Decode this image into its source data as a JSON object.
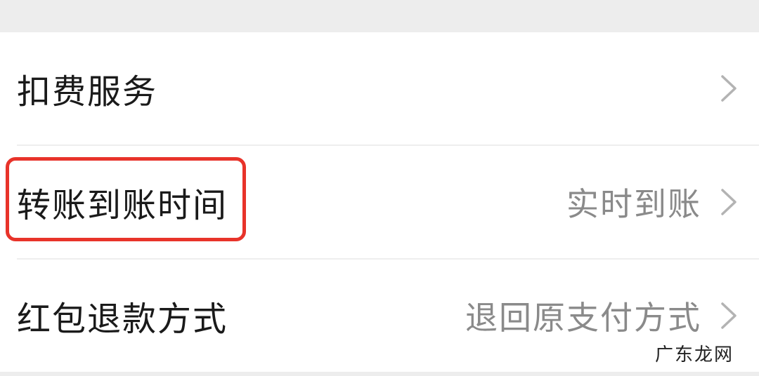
{
  "settings": {
    "rows": [
      {
        "label": "扣费服务",
        "value": ""
      },
      {
        "label": "转账到账时间",
        "value": "实时到账"
      },
      {
        "label": "红包退款方式",
        "value": "退回原支付方式"
      }
    ]
  },
  "annotation": {
    "highlight_color": "#e8332a"
  },
  "watermark": {
    "text": "广东龙网"
  },
  "icons": {
    "row_arrow": "chevron-right-icon"
  }
}
